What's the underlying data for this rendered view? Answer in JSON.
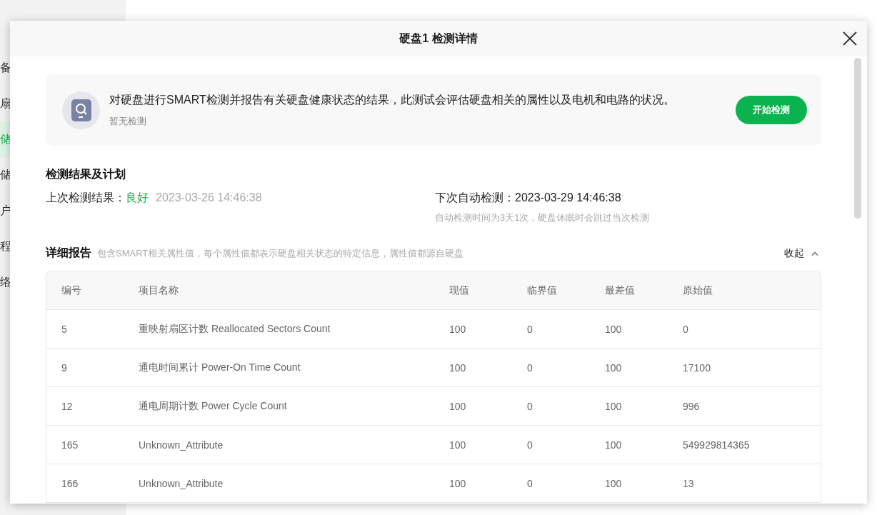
{
  "sidebar": {
    "items": [
      {
        "label": "备",
        "selected": false
      },
      {
        "label": "扇",
        "selected": false
      },
      {
        "label": "储",
        "selected": true
      },
      {
        "label": "储",
        "selected": false
      },
      {
        "label": "户",
        "selected": false
      },
      {
        "label": "程",
        "selected": false
      },
      {
        "label": "络",
        "selected": false
      }
    ]
  },
  "dialog": {
    "title": "硬盘1 检测详情",
    "intro": {
      "description": "对硬盘进行SMART检测并报告有关硬盘健康状态的结果，此测试会评估硬盘相关的属性以及电机和电路的状况。",
      "status": "暂无检测",
      "button": "开始检测"
    },
    "results": {
      "title": "检测结果及计划",
      "last_label": "上次检测结果：",
      "last_result": "良好",
      "last_time": "2023-03-26 14:46:38",
      "next_label": "下次自动检测：",
      "next_time": "2023-03-29 14:46:38",
      "note": "自动检测时间为3天1次，硬盘休眠时会跳过当次检测"
    },
    "report": {
      "title": "详细报告",
      "description": "包含SMART相关属性值，每个属性值都表示硬盘相关状态的特定信息，属性值都源自硬盘",
      "toggle": "收起",
      "expanded": true,
      "table": {
        "columns": [
          "编号",
          "项目名称",
          "现值",
          "临界值",
          "最差值",
          "原始值"
        ],
        "rows": [
          [
            "5",
            "重映射扇区计数 Reallocated Sectors Count",
            "100",
            "0",
            "100",
            "0"
          ],
          [
            "9",
            "通电时间累计 Power-On Time Count",
            "100",
            "0",
            "100",
            "17100"
          ],
          [
            "12",
            "通电周期计数 Power Cycle Count",
            "100",
            "0",
            "100",
            "996"
          ],
          [
            "165",
            "Unknown_Attribute",
            "100",
            "0",
            "100",
            "549929814365"
          ],
          [
            "166",
            "Unknown_Attribute",
            "100",
            "0",
            "100",
            "13"
          ]
        ]
      }
    }
  }
}
